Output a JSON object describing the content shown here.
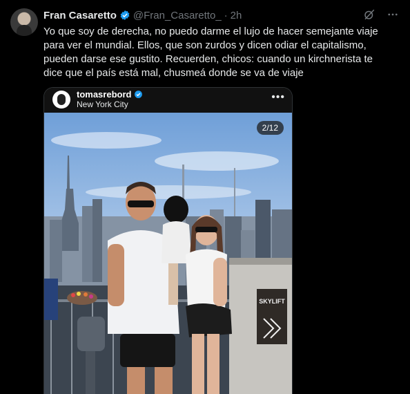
{
  "tweet": {
    "display_name": "Fran Casaretto",
    "handle": "@Fran_Casaretto_",
    "separator": "·",
    "time": "2h",
    "text": "Yo que soy de derecha, no puedo darme el lujo de hacer semejante viaje para ver el mundial. Ellos, que son zurdos y dicen odiar el capitalismo, pueden darse ese gustito. Recuerden, chicos: cuando un kirchnerista te dice que el país está mal, chusmeá donde se va de viaje"
  },
  "embedded_post": {
    "username": "tomasrebord",
    "location": "New York City",
    "more": "•••",
    "counter": "2/12",
    "sign_text": "SKYLIFT"
  },
  "icons": {
    "verified": "verified-badge-icon",
    "grok": "grok-icon",
    "more": "more-horizontal-icon"
  },
  "colors": {
    "background": "#000000",
    "verified": "#1d9bf0",
    "secondary_text": "#71767b"
  }
}
